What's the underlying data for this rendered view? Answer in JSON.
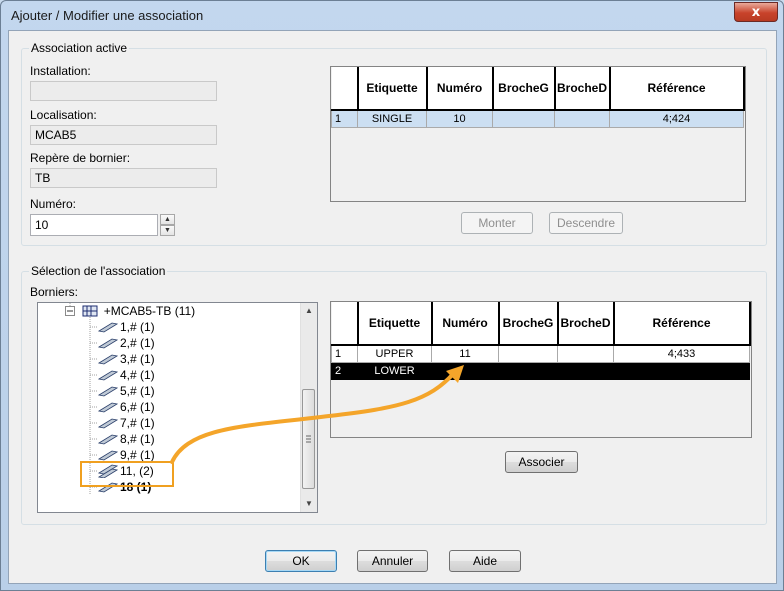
{
  "window": {
    "title": "Ajouter / Modifier une association",
    "close_glyph": "x"
  },
  "active_group": {
    "legend": "Association active",
    "installation_label": "Installation:",
    "installation_value": "",
    "localisation_label": "Localisation:",
    "localisation_value": "MCAB5",
    "repere_label": "Repère de bornier:",
    "repere_value": "TB",
    "numero_label": "Numéro:",
    "numero_value": "10",
    "grid": {
      "columns": [
        "",
        "Etiquette",
        "Numéro",
        "BrocheG",
        "BrocheD",
        "Référence"
      ],
      "rows": [
        [
          "1",
          "SINGLE",
          "10",
          "",
          "",
          "4;424"
        ]
      ]
    },
    "monter_label": "Monter",
    "descendre_label": "Descendre"
  },
  "selection_group": {
    "legend": "Sélection de l'association",
    "borniers_label": "Borniers:",
    "tree": {
      "root_label": "+MCAB5-TB (11)",
      "items": [
        "1,# (1)",
        "2,# (1)",
        "3,# (1)",
        "4,# (1)",
        "5,# (1)",
        "6,# (1)",
        "7,# (1)",
        "8,# (1)",
        "9,# (1)",
        "11,  (2)",
        "18 (1)"
      ]
    },
    "grid": {
      "columns": [
        "",
        "Etiquette",
        "Numéro",
        "BrocheG",
        "BrocheD",
        "Référence"
      ],
      "rows": [
        [
          "1",
          "UPPER",
          "11",
          "",
          "",
          "4;433"
        ],
        [
          "2",
          "LOWER",
          "",
          "",
          "",
          ""
        ]
      ]
    },
    "associer_label": "Associer"
  },
  "footer": {
    "ok_label": "OK",
    "annuler_label": "Annuler",
    "aide_label": "Aide"
  },
  "colors": {
    "highlight_orange": "#f0a020",
    "selected_row": "#ccdff2",
    "close_red": "#c8432b"
  }
}
